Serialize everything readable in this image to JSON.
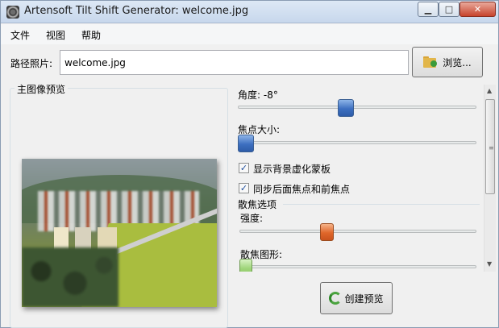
{
  "window": {
    "title": "Artensoft Tilt Shift Generator: welcome.jpg",
    "minimize_glyph": "▁",
    "maximize_glyph": "□",
    "close_glyph": "✕"
  },
  "menu": {
    "items": [
      {
        "label": "文件"
      },
      {
        "label": "视图"
      },
      {
        "label": "帮助"
      }
    ]
  },
  "path": {
    "label": "路径照片:",
    "value": "welcome.jpg",
    "browse_label": "浏览..."
  },
  "preview": {
    "legend": "主图像预览"
  },
  "settings": {
    "angle_label": "角度: -8°",
    "angle_value_degrees": -8,
    "angle_slider_fraction": 0.45,
    "focus_size_label": "焦点大小:",
    "focus_size_fraction": 0.0,
    "show_blur_mask_label": "显示背景虚化蒙板",
    "show_blur_mask_checked": true,
    "sync_focus_label": "同步后面焦点和前焦点",
    "sync_focus_checked": true,
    "bokeh_group_label": "散焦选项",
    "strength_label": "强度:",
    "strength_fraction": 0.36,
    "bokeh_shape_label": "散焦图形:",
    "bokeh_shape_fraction": 0.0
  },
  "scrollbar": {
    "up_glyph": "▲",
    "down_glyph": "▼",
    "grip_glyph": "≡"
  },
  "actions": {
    "create_preview_label": "创建预览"
  },
  "colors": {
    "angle_thumb": "#3d6fc0",
    "strength_thumb": "#e0662a",
    "bokeh_thumb": "#9fd57a"
  }
}
